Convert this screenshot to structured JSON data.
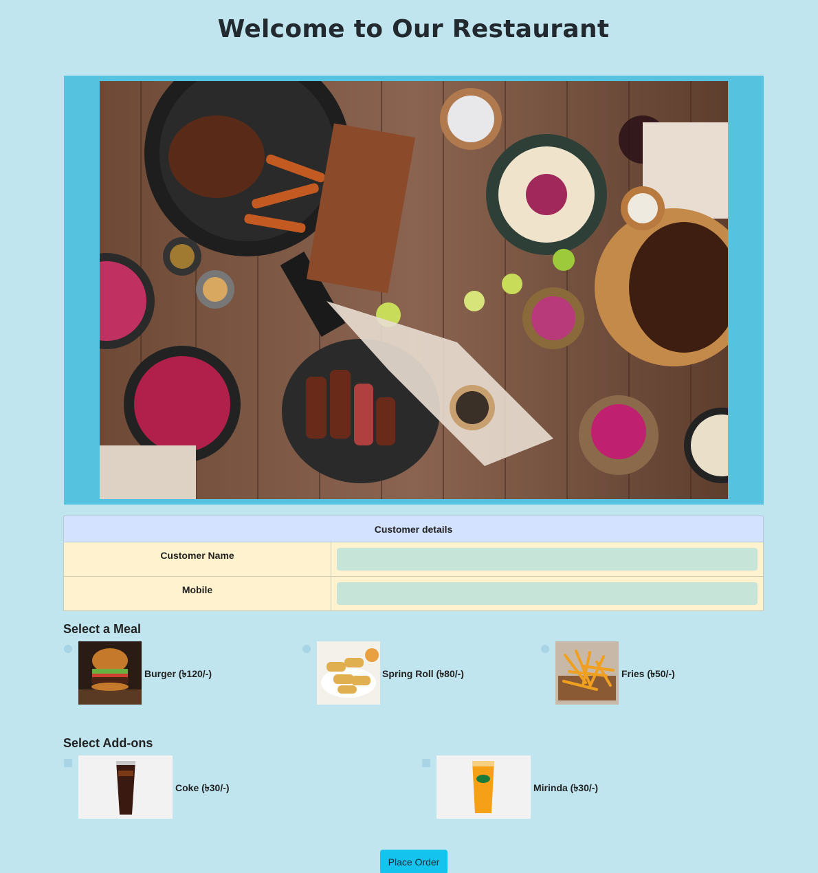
{
  "page": {
    "title": "Welcome to Our Restaurant"
  },
  "customer": {
    "header": "Customer details",
    "name_label": "Customer Name",
    "name_value": "",
    "mobile_label": "Mobile",
    "mobile_value": ""
  },
  "meals": {
    "title": "Select a Meal",
    "items": [
      {
        "label": "Burger (৳120/-)"
      },
      {
        "label": "Spring Roll (৳80/-)"
      },
      {
        "label": "Fries (৳50/-)"
      }
    ]
  },
  "addons": {
    "title": "Select Add-ons",
    "items": [
      {
        "label": "Coke (৳30/-)"
      },
      {
        "label": "Mirinda (৳30/-)"
      }
    ]
  },
  "actions": {
    "place_order": "Place Order"
  },
  "colors": {
    "background": "#c0e5ef",
    "hero_frame": "#55c2df",
    "button": "#14c3ee"
  }
}
